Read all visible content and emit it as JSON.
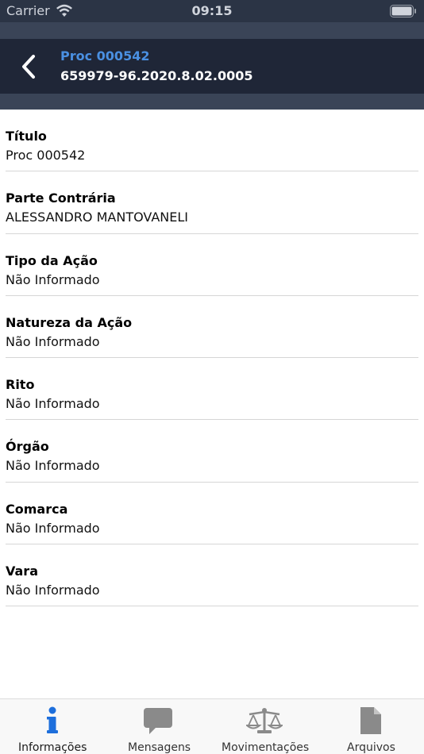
{
  "status_bar": {
    "carrier": "Carrier",
    "time": "09:15"
  },
  "nav": {
    "title": "Proc 000542",
    "subtitle": "659979-96.2020.8.02.0005",
    "back_icon": "chevron-left-icon"
  },
  "fields": [
    {
      "label": "Título",
      "value": "Proc 000542"
    },
    {
      "label": "Parte Contrária",
      "value": "ALESSANDRO MANTOVANELI"
    },
    {
      "label": "Tipo da Ação",
      "value": "Não Informado"
    },
    {
      "label": "Natureza da Ação",
      "value": "Não Informado"
    },
    {
      "label": "Rito",
      "value": "Não Informado"
    },
    {
      "label": "Órgão",
      "value": "Não Informado"
    },
    {
      "label": "Comarca",
      "value": "Não Informado"
    },
    {
      "label": "Vara",
      "value": "Não Informado"
    }
  ],
  "tabs": [
    {
      "label": "Informações",
      "icon": "info-icon",
      "active": true
    },
    {
      "label": "Mensagens",
      "icon": "message-bubble-icon",
      "active": false
    },
    {
      "label": "Movimentações",
      "icon": "scales-icon",
      "active": false
    },
    {
      "label": "Arquivos",
      "icon": "document-icon",
      "active": false
    }
  ],
  "colors": {
    "nav_background": "#1f2637",
    "band_background": "#3a4457",
    "accent": "#4a90e2",
    "tab_active_icon": "#1e6fdc",
    "tab_inactive_icon": "#8a8a8a"
  }
}
